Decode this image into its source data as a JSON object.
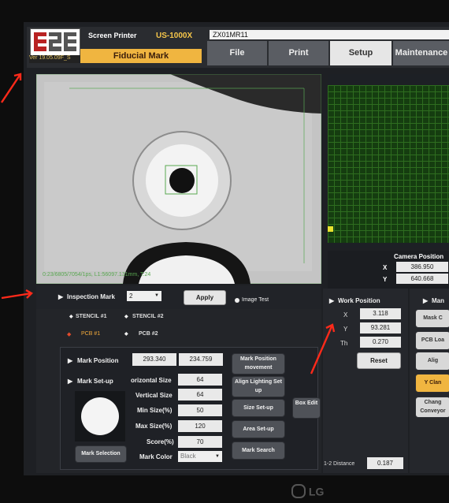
{
  "header": {
    "logo_text": "ESE",
    "version": "Ver 19.05.09F_S",
    "title": "Screen Printer",
    "model": "US-1000X",
    "mode": "Fiducial Mark",
    "job": "ZX01MR11"
  },
  "tabs": [
    "File",
    "Print",
    "Setup",
    "Maintenance"
  ],
  "camera": {
    "overlay_text": "0:23/6805/7054/1ps, L1:56097.131mm, T:24"
  },
  "camera_position": {
    "title": "Camera Position",
    "x_label": "X",
    "x": "386.950",
    "y_label": "Y",
    "y": "640.668"
  },
  "inspection": {
    "label": "Inspection Mark",
    "value": "2",
    "apply": "Apply",
    "image_test": "Image Test"
  },
  "marks": {
    "stencil1": "STENCIL #1",
    "stencil2": "STENCIL #2",
    "pcb1": "PCB #1",
    "pcb2": "PCB #2"
  },
  "mark_position": {
    "label": "Mark Position",
    "x": "293.340",
    "y": "234.759"
  },
  "mark_setup": {
    "label": "Mark Set-up"
  },
  "fields": {
    "horizontal_label": "orizontal Size",
    "horizontal": "64",
    "vertical_label": "Vertical Size",
    "vertical": "64",
    "min_label": "Min Size(%)",
    "min": "50",
    "max_label": "Max Size(%)",
    "max": "120",
    "score_label": "Score(%)",
    "score": "70",
    "color_label": "Mark Color",
    "color": "Black"
  },
  "buttons": {
    "mark_selection": "Mark Selection",
    "mark_position_movement": "Mark Position movement",
    "align_lighting": "Align Lighting Set up",
    "size_setup": "Size Set-up",
    "area_setup": "Area Set-up",
    "mark_search": "Mark Search",
    "box_edit": "Box Edit"
  },
  "work_position": {
    "label": "Work Position",
    "x_label": "X",
    "x": "3.118",
    "y_label": "Y",
    "y": "93.281",
    "th_label": "Th",
    "th": "0.270",
    "reset": "Reset",
    "distance_label": "1-2 Distance",
    "distance": "0.187"
  },
  "right_panel": {
    "label": "Man",
    "b1": "Mask C",
    "b2": "PCB Loa",
    "b3": "Alig",
    "b4": "Y Clan",
    "b5": "Chang Conveyor"
  },
  "brand": "LG"
}
